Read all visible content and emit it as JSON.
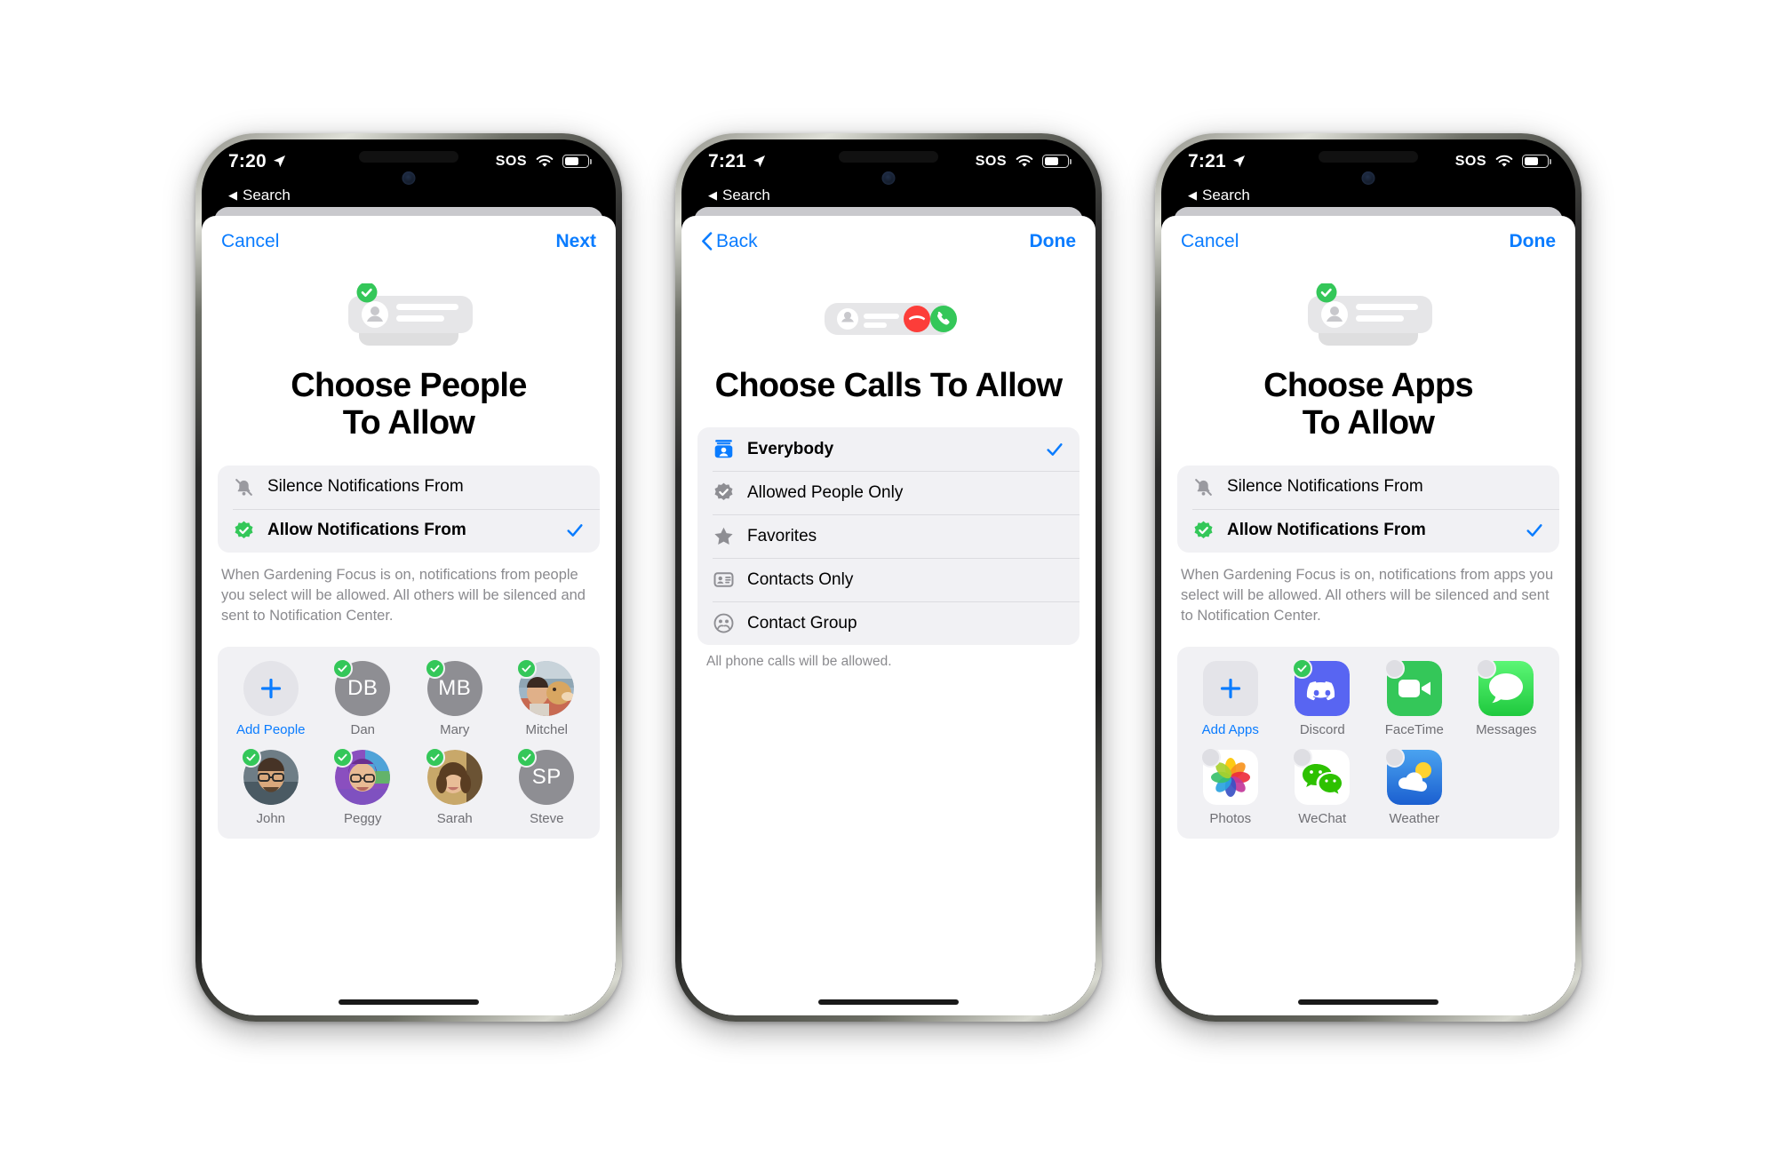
{
  "colors": {
    "accent_blue": "#0a7cff",
    "green": "#34c759",
    "red": "#fc3d39",
    "grey_text": "#8a8a8e",
    "group_bg": "#f1f1f4"
  },
  "phones": [
    {
      "id": "phone-people",
      "status": {
        "time": "7:20",
        "location_icon": "location-arrow-icon",
        "sos": "SOS",
        "wifi_icon": "wifi-icon",
        "battery_icon": "battery-icon"
      },
      "back_link": {
        "label": "Search",
        "icon": "back-triangle-icon"
      },
      "nav": {
        "left_label": "Cancel",
        "left_icon": null,
        "right_label": "Next"
      },
      "hero_icon": "person-notification-allow-icon",
      "title": "Choose People\nTo Allow",
      "title_line1": "Choose People",
      "title_line2": "To Allow",
      "options": [
        {
          "label": "Silence Notifications From",
          "icon": "bell-slash-icon",
          "selected": false
        },
        {
          "label": "Allow Notifications From",
          "icon": "checkmark-seal-icon",
          "selected": true
        }
      ],
      "blurb": "When Gardening Focus is on, notifications from people you select will be allowed. All others will be silenced and sent to Notification Center.",
      "panel_kind": "people",
      "items": [
        {
          "name": "Add People",
          "kind": "add",
          "badge": null,
          "avatar": "plus-icon"
        },
        {
          "name": "Dan",
          "kind": "initials",
          "initials": "DB",
          "badge": "checked"
        },
        {
          "name": "Mary",
          "kind": "initials",
          "initials": "MB",
          "badge": "checked"
        },
        {
          "name": "Mitchel",
          "kind": "photo",
          "photo": "man-with-dog-photo",
          "badge": "checked"
        },
        {
          "name": "John",
          "kind": "photo",
          "photo": "man-glasses-photo",
          "badge": "checked"
        },
        {
          "name": "Peggy",
          "kind": "photo",
          "photo": "woman-glasses-photo",
          "badge": "checked"
        },
        {
          "name": "Sarah",
          "kind": "photo",
          "photo": "woman-curly-hair-photo",
          "badge": "checked"
        },
        {
          "name": "Steve",
          "kind": "initials",
          "initials": "SP",
          "badge": "checked"
        }
      ]
    },
    {
      "id": "phone-calls",
      "status": {
        "time": "7:21",
        "location_icon": "location-arrow-icon",
        "sos": "SOS",
        "wifi_icon": "wifi-icon",
        "battery_icon": "battery-icon"
      },
      "back_link": {
        "label": "Search",
        "icon": "back-triangle-icon"
      },
      "nav": {
        "left_label": "Back",
        "left_icon": "chevron-left-icon",
        "right_label": "Done"
      },
      "hero_icon": "call-allow-icon",
      "title_line1": "Choose Calls To Allow",
      "title_line2": "",
      "list": [
        {
          "label": "Everybody",
          "icon": "contact-card-blue-icon",
          "checked": true
        },
        {
          "label": "Allowed People Only",
          "icon": "checkmark-seal-grey-icon",
          "checked": false
        },
        {
          "label": "Favorites",
          "icon": "star-icon",
          "checked": false
        },
        {
          "label": "Contacts Only",
          "icon": "contact-card-icon",
          "checked": false
        },
        {
          "label": "Contact Group",
          "icon": "people-circle-icon",
          "checked": false
        }
      ],
      "footnote": "All phone calls will be allowed."
    },
    {
      "id": "phone-apps",
      "status": {
        "time": "7:21",
        "location_icon": "location-arrow-icon",
        "sos": "SOS",
        "wifi_icon": "wifi-icon",
        "battery_icon": "battery-icon"
      },
      "back_link": {
        "label": "Search",
        "icon": "back-triangle-icon"
      },
      "nav": {
        "left_label": "Cancel",
        "left_icon": null,
        "right_label": "Done"
      },
      "hero_icon": "person-notification-allow-icon",
      "title_line1": "Choose Apps",
      "title_line2": "To Allow",
      "options": [
        {
          "label": "Silence Notifications From",
          "icon": "bell-slash-icon",
          "selected": false
        },
        {
          "label": "Allow Notifications From",
          "icon": "checkmark-seal-icon",
          "selected": true
        }
      ],
      "blurb": "When Gardening Focus is on, notifications from apps you select will be allowed. All others will be silenced and sent to Notification Center.",
      "panel_kind": "apps",
      "items": [
        {
          "name": "Add Apps",
          "kind": "add",
          "badge": null,
          "avatar": "plus-icon"
        },
        {
          "name": "Discord",
          "kind": "app",
          "app": "discord-app-icon",
          "badge": "checked"
        },
        {
          "name": "FaceTime",
          "kind": "app",
          "app": "facetime-app-icon",
          "badge": "empty"
        },
        {
          "name": "Messages",
          "kind": "app",
          "app": "messages-app-icon",
          "badge": "empty"
        },
        {
          "name": "Photos",
          "kind": "app",
          "app": "photos-app-icon",
          "badge": "empty"
        },
        {
          "name": "WeChat",
          "kind": "app",
          "app": "wechat-app-icon",
          "badge": "empty"
        },
        {
          "name": "Weather",
          "kind": "app",
          "app": "weather-app-icon",
          "badge": "empty"
        }
      ]
    }
  ]
}
